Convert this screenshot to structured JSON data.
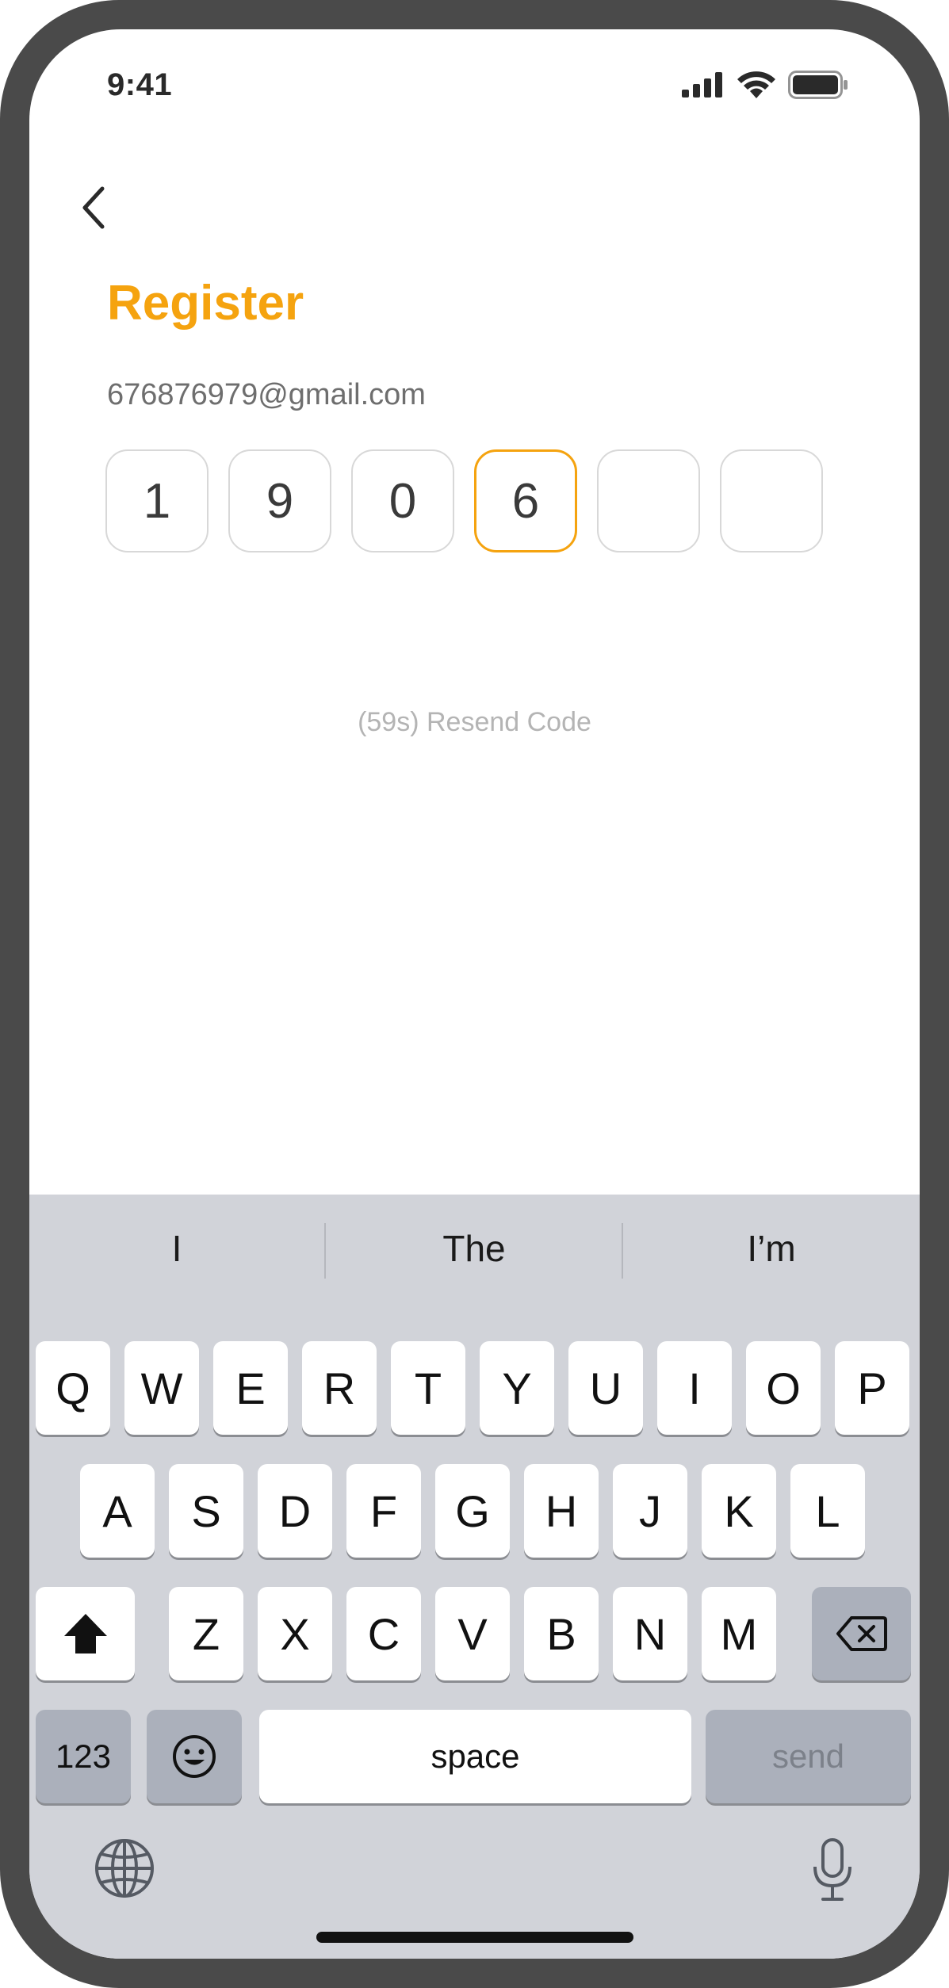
{
  "status": {
    "time": "9:41"
  },
  "page": {
    "title": "Register",
    "email": "676876979@gmail.com",
    "code": [
      "1",
      "9",
      "0",
      "6",
      "",
      ""
    ],
    "resend": "(59s) Resend Code"
  },
  "colors": {
    "accent": "#F5A30F",
    "frame": "#4a4a4a",
    "keyboard_bg": "#d1d3d9"
  },
  "keyboard": {
    "suggestions": [
      "I",
      "The",
      "I’m"
    ],
    "row1": [
      "Q",
      "W",
      "E",
      "R",
      "T",
      "Y",
      "U",
      "I",
      "O",
      "P"
    ],
    "row2": [
      "A",
      "S",
      "D",
      "F",
      "G",
      "H",
      "J",
      "K",
      "L"
    ],
    "row3": [
      "Z",
      "X",
      "C",
      "V",
      "B",
      "N",
      "M"
    ],
    "numbers_label": "123",
    "space_label": "space",
    "send_label": "send",
    "icons": [
      "shift-icon",
      "backspace-icon",
      "emoji-icon",
      "globe-icon",
      "microphone-icon"
    ]
  }
}
